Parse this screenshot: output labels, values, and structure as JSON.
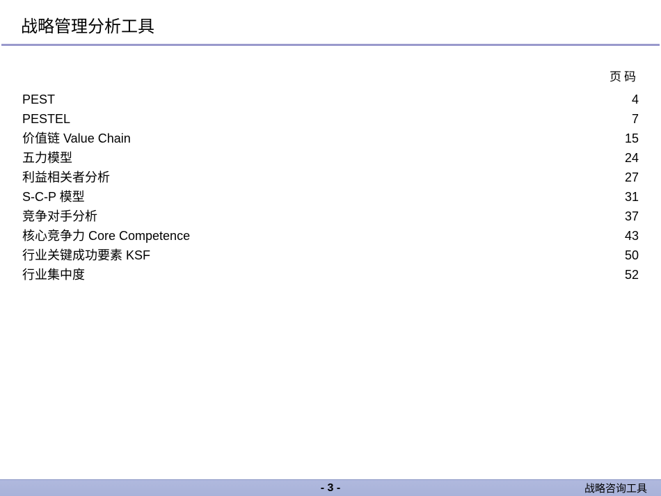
{
  "header": {
    "title": "战略管理分析工具"
  },
  "toc": {
    "pageHeader": "页码",
    "items": [
      {
        "label": "PEST",
        "page": "4"
      },
      {
        "label": "PESTEL",
        "page": "7"
      },
      {
        "label": "价值链 Value Chain",
        "page": "15"
      },
      {
        "label": "五力模型",
        "page": "24"
      },
      {
        "label": "利益相关者分析",
        "page": "27"
      },
      {
        "label": "S-C-P 模型",
        "page": "31"
      },
      {
        "label": "竞争对手分析",
        "page": "37"
      },
      {
        "label": "核心竞争力 Core Competence",
        "page": "43"
      },
      {
        "label": "行业关键成功要素 KSF",
        "page": "50"
      },
      {
        "label": "行业集中度",
        "page": "52"
      }
    ]
  },
  "footer": {
    "pageNumber": "- 3 -",
    "rightText": "战略咨询工具"
  }
}
